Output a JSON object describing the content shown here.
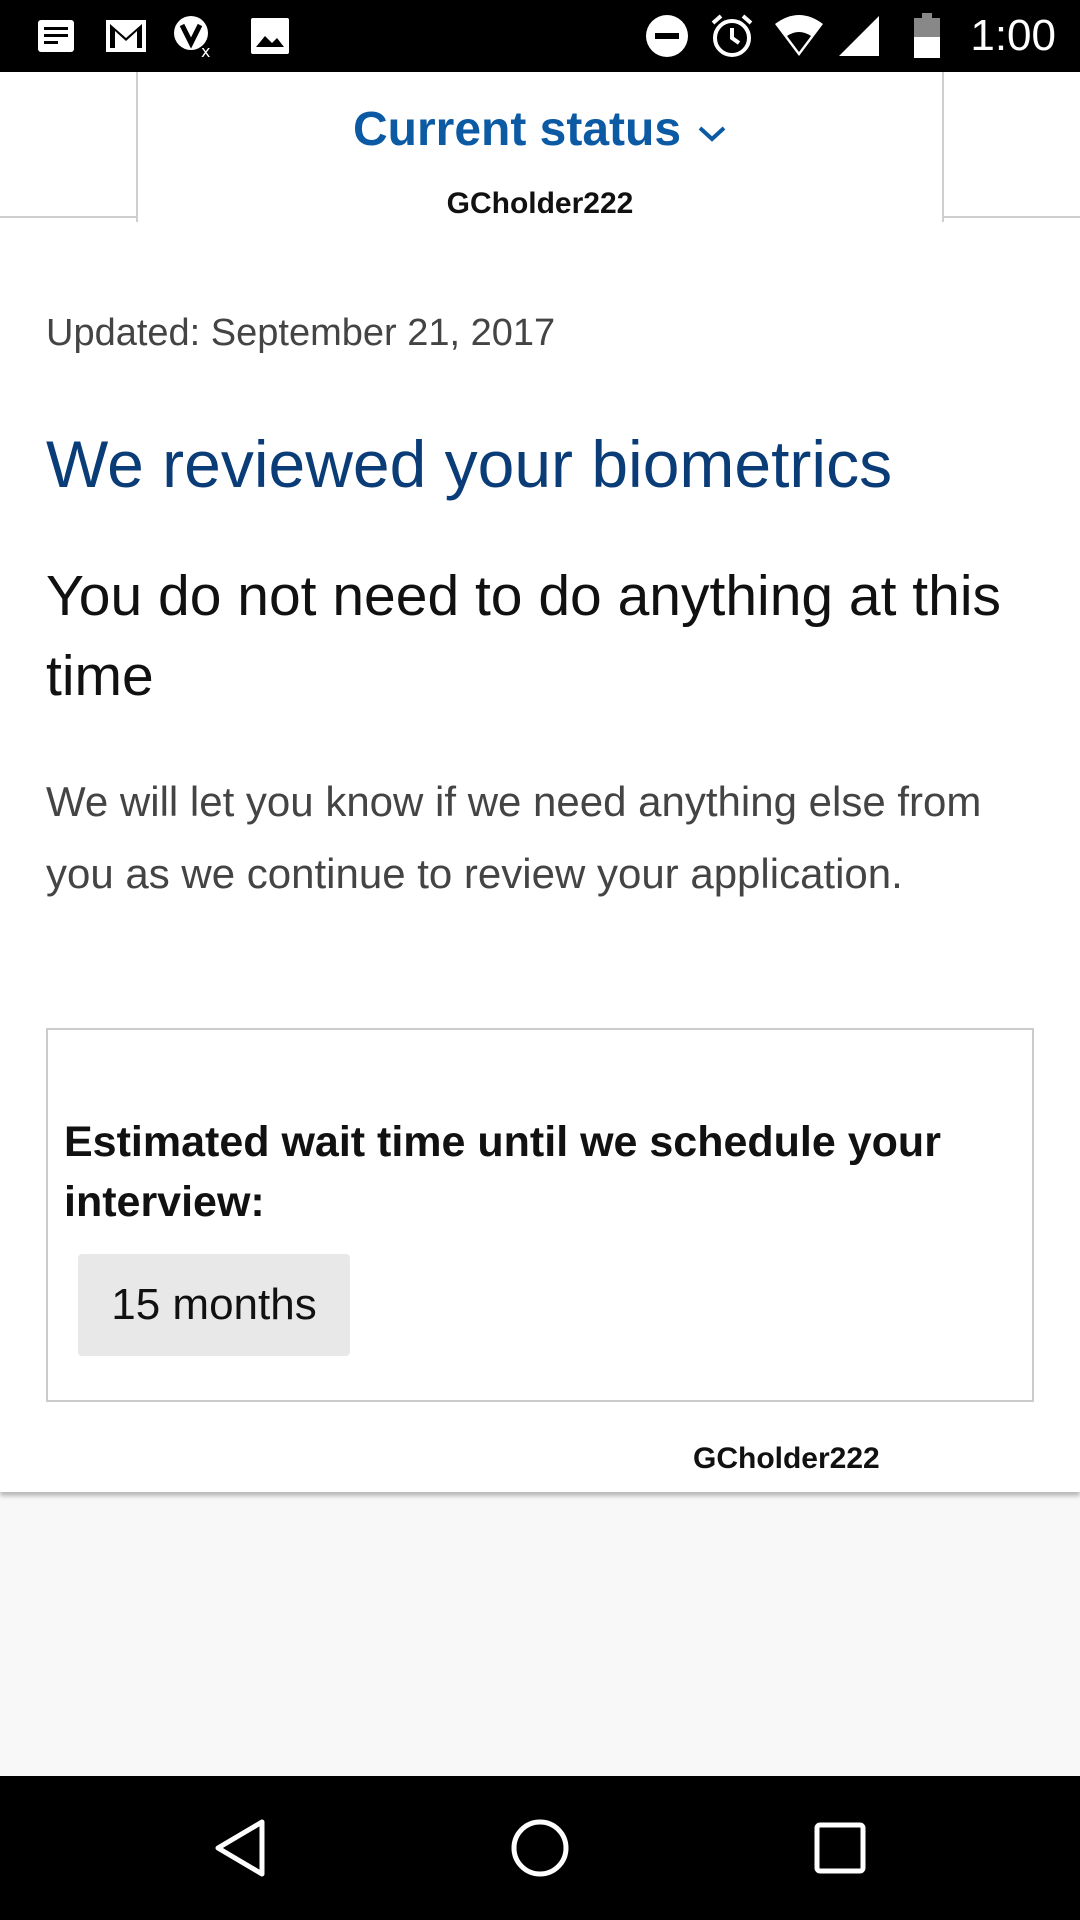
{
  "status_bar": {
    "time": "1:00",
    "icons": [
      "notes-icon",
      "gmail-icon",
      "vpn-badge-icon",
      "image-icon",
      "do-not-disturb-icon",
      "alarm-icon",
      "wifi-icon",
      "signal-icon",
      "battery-icon"
    ]
  },
  "tab": {
    "title": "Current status",
    "username": "GCholder222"
  },
  "card": {
    "updated": "Updated: September 21, 2017",
    "headline": "We reviewed your biometrics",
    "subhead": "You do not need to do anything at this time",
    "body": "We will let you know if we need anything else from you as we continue to review your application.",
    "wait_label": "Estimated wait time until we schedule your interview:",
    "wait_value": "15 months",
    "watermark": "GCholder222"
  },
  "nav_bar": {
    "buttons": [
      "back-icon",
      "home-icon",
      "recents-icon"
    ]
  },
  "colors": {
    "link_blue": "#0c5aa3",
    "headline_blue": "#0a3d78"
  }
}
